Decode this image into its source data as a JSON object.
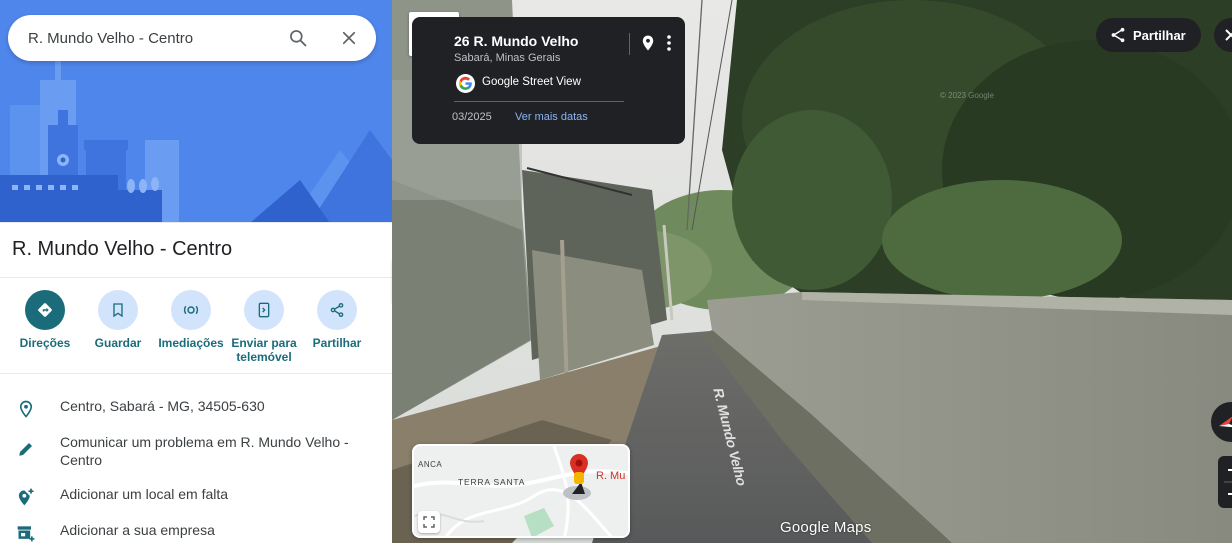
{
  "search": {
    "value": "R. Mundo Velho - Centro",
    "search_icon": "search-icon",
    "clear_icon": "close-icon"
  },
  "place": {
    "title": "R. Mundo Velho - Centro"
  },
  "actions": [
    {
      "label": "Direções",
      "icon": "directions-icon"
    },
    {
      "label": "Guardar",
      "icon": "bookmark-icon"
    },
    {
      "label": "Imediações",
      "icon": "nearby-icon"
    },
    {
      "label": "Enviar para telemóvel",
      "icon": "send-to-phone-icon"
    },
    {
      "label": "Partilhar",
      "icon": "share-icon"
    }
  ],
  "info_rows": [
    {
      "text": "Centro, Sabará - MG, 34505-630",
      "icon": "location-pin-icon"
    },
    {
      "text": "Comunicar um problema em R. Mundo Velho - Centro",
      "icon": "pencil-icon"
    },
    {
      "text": "Adicionar um local em falta",
      "icon": "add-place-icon"
    },
    {
      "text": "Adicionar a sua empresa",
      "icon": "add-business-icon"
    }
  ],
  "street_view": {
    "card": {
      "title": "26 R. Mundo Velho",
      "subtitle": "Sabará, Minas Gerais",
      "provider": "Google Street View",
      "date": "03/2025",
      "more_dates": "Ver mais datas"
    },
    "share_label": "Partilhar",
    "watermark": "© 2023 Google",
    "road_marking": "R. Mundo Velho",
    "logo": "Google Maps",
    "minimap": {
      "label_left": "ANCA",
      "label_terra": "TERRA SANTA",
      "label_pin": "R. Mu"
    }
  },
  "colors": {
    "accent": "#1a6c7a",
    "hero_blue": "#4f86ec",
    "card_bg": "#202124",
    "link": "#8ab4f8",
    "pin_red": "#d93025"
  }
}
